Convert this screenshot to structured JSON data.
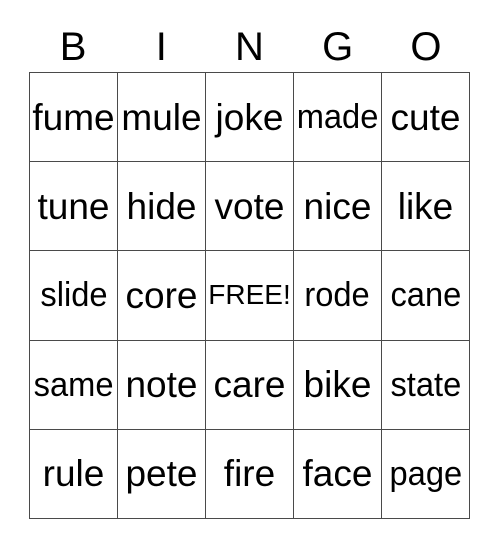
{
  "card": {
    "header": {
      "letters": [
        "B",
        "I",
        "N",
        "G",
        "O"
      ]
    },
    "colors": {
      "background": "#ffffff",
      "text": "#000000",
      "grid_line": "#4a4a4a"
    },
    "rows": [
      [
        {
          "text": "fume",
          "free": false,
          "tight": false
        },
        {
          "text": "mule",
          "free": false,
          "tight": false
        },
        {
          "text": "joke",
          "free": false,
          "tight": false
        },
        {
          "text": "made",
          "free": false,
          "tight": true
        },
        {
          "text": "cute",
          "free": false,
          "tight": false
        }
      ],
      [
        {
          "text": "tune",
          "free": false,
          "tight": false
        },
        {
          "text": "hide",
          "free": false,
          "tight": false
        },
        {
          "text": "vote",
          "free": false,
          "tight": false
        },
        {
          "text": "nice",
          "free": false,
          "tight": false
        },
        {
          "text": "like",
          "free": false,
          "tight": false
        }
      ],
      [
        {
          "text": "slide",
          "free": false,
          "tight": true
        },
        {
          "text": "core",
          "free": false,
          "tight": false
        },
        {
          "text": "FREE!",
          "free": true,
          "tight": false
        },
        {
          "text": "rode",
          "free": false,
          "tight": true
        },
        {
          "text": "cane",
          "free": false,
          "tight": true
        }
      ],
      [
        {
          "text": "same",
          "free": false,
          "tight": true
        },
        {
          "text": "note",
          "free": false,
          "tight": false
        },
        {
          "text": "care",
          "free": false,
          "tight": false
        },
        {
          "text": "bike",
          "free": false,
          "tight": false
        },
        {
          "text": "state",
          "free": false,
          "tight": true
        }
      ],
      [
        {
          "text": "rule",
          "free": false,
          "tight": false
        },
        {
          "text": "pete",
          "free": false,
          "tight": false
        },
        {
          "text": "fire",
          "free": false,
          "tight": false
        },
        {
          "text": "face",
          "free": false,
          "tight": false
        },
        {
          "text": "page",
          "free": false,
          "tight": true
        }
      ]
    ]
  }
}
